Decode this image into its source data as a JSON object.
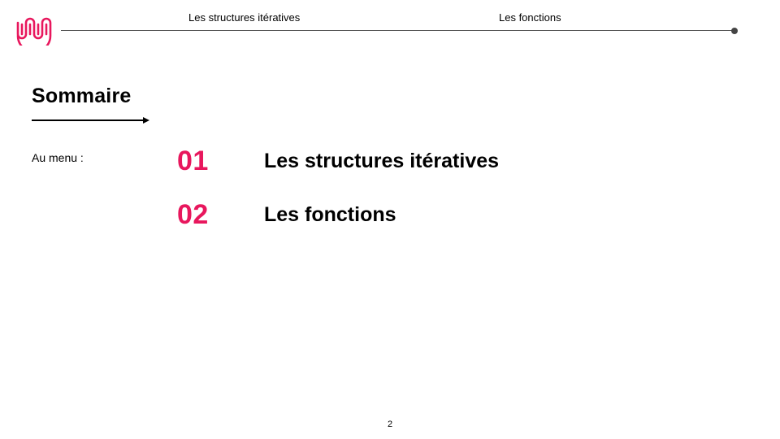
{
  "colors": {
    "accent": "#e8175d",
    "text": "#000000",
    "line": "#555555"
  },
  "header": {
    "logo_icon": "wave-logo-icon",
    "nav": [
      {
        "label": "Les structures itératives"
      },
      {
        "label": "Les fonctions"
      }
    ]
  },
  "main": {
    "title": "Sommaire",
    "menu_label": "Au menu :",
    "items": [
      {
        "number": "01",
        "label": "Les structures itératives"
      },
      {
        "number": "02",
        "label": "Les fonctions"
      }
    ]
  },
  "footer": {
    "page_number": "2"
  }
}
